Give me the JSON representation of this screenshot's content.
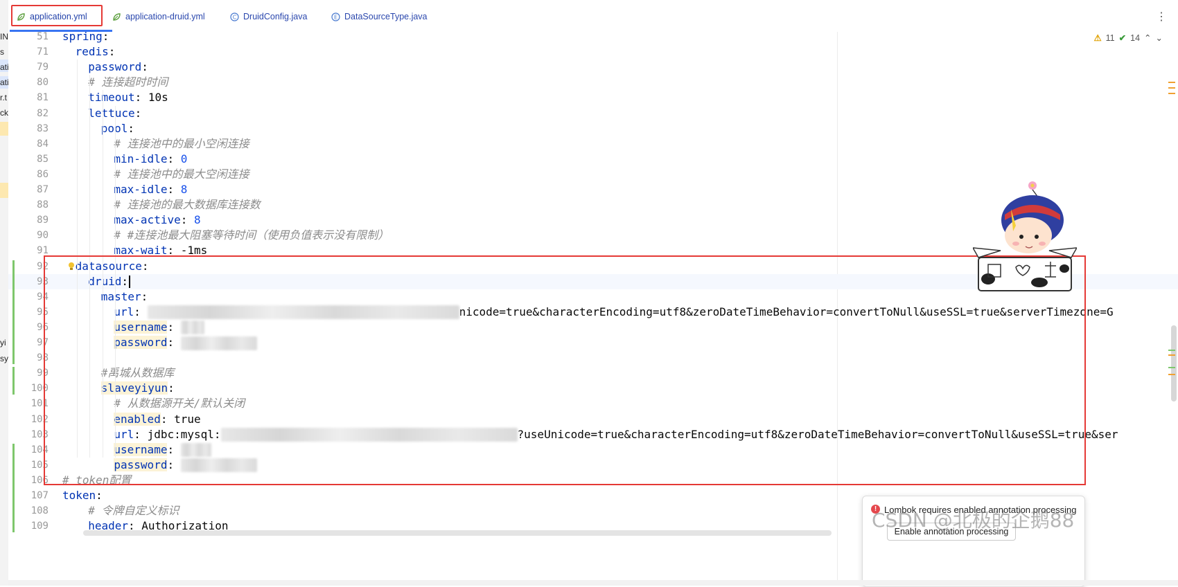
{
  "tabs": [
    {
      "label": "application.yml",
      "icon": "yaml-spring-icon",
      "active": true
    },
    {
      "label": "application-druid.yml",
      "icon": "yaml-spring-icon",
      "active": false
    },
    {
      "label": "DruidConfig.java",
      "icon": "java-class-icon",
      "active": false
    },
    {
      "label": "DataSourceType.java",
      "icon": "java-enum-icon",
      "active": false
    }
  ],
  "inspections": {
    "warnings": "11",
    "ok": "14"
  },
  "sidebar_fragments": [
    "IN",
    "s",
    "ati",
    "ati",
    "r.t",
    "ck.",
    "yi",
    "sy"
  ],
  "lines": [
    {
      "n": "51",
      "indent": 0,
      "key": "spring",
      "sep": ":",
      "val": ""
    },
    {
      "n": "71",
      "indent": 1,
      "key": "redis",
      "sep": ":",
      "val": ""
    },
    {
      "n": "79",
      "indent": 2,
      "key": "password",
      "sep": ":",
      "val": ""
    },
    {
      "n": "80",
      "indent": 2,
      "comment": "# 连接超时时间"
    },
    {
      "n": "81",
      "indent": 2,
      "key": "timeout",
      "sep": ":",
      "val": " 10s"
    },
    {
      "n": "82",
      "indent": 2,
      "key": "lettuce",
      "sep": ":",
      "val": ""
    },
    {
      "n": "83",
      "indent": 3,
      "key": "pool",
      "sep": ":",
      "val": ""
    },
    {
      "n": "84",
      "indent": 4,
      "comment": "# 连接池中的最小空闲连接"
    },
    {
      "n": "85",
      "indent": 4,
      "key": "min-idle",
      "sep": ":",
      "num": " 0"
    },
    {
      "n": "86",
      "indent": 4,
      "comment": "# 连接池中的最大空闲连接"
    },
    {
      "n": "87",
      "indent": 4,
      "key": "max-idle",
      "sep": ":",
      "num": " 8"
    },
    {
      "n": "88",
      "indent": 4,
      "comment": "# 连接池的最大数据库连接数"
    },
    {
      "n": "89",
      "indent": 4,
      "key": "max-active",
      "sep": ":",
      "num": " 8"
    },
    {
      "n": "90",
      "indent": 4,
      "comment": "# #连接池最大阻塞等待时间（使用负值表示没有限制）"
    },
    {
      "n": "91",
      "indent": 4,
      "key": "max-wait",
      "sep": ":",
      "val": " -1ms"
    },
    {
      "n": "92",
      "indent": 1,
      "key": "datasource",
      "sep": ":",
      "val": "",
      "bulb": true
    },
    {
      "n": "93",
      "indent": 2,
      "key": "druid",
      "sep": ":",
      "val": "",
      "caret": true
    },
    {
      "n": "94",
      "indent": 3,
      "key": "master",
      "sep": ":",
      "val": ""
    },
    {
      "n": "95",
      "indent": 4,
      "key": "url",
      "sep": ":",
      "val": " ",
      "blur": 450,
      "tail": "nicode=true&characterEncoding=utf8&zeroDateTimeBehavior=convertToNull&useSSL=true&serverTimezone=G"
    },
    {
      "n": "96",
      "indent": 4,
      "key": "username",
      "sep": ":",
      "val": " ",
      "blur": 34,
      "hlkey": true
    },
    {
      "n": "97",
      "indent": 4,
      "key": "password",
      "sep": ":",
      "val": " ",
      "blur": 110,
      "hlkey": true
    },
    {
      "n": "98",
      "indent": 0,
      "blank": true
    },
    {
      "n": "99",
      "indent": 3,
      "comment": "#禹城从数据库"
    },
    {
      "n": "100",
      "indent": 3,
      "key": "slaveyiyun",
      "sep": ":",
      "val": "",
      "hlkey": true
    },
    {
      "n": "101",
      "indent": 4,
      "comment": "# 从数据源开关/默认关闭"
    },
    {
      "n": "102",
      "indent": 4,
      "key": "enabled",
      "sep": ":",
      "val": " true",
      "hlkey": true
    },
    {
      "n": "103",
      "indent": 4,
      "key": "url",
      "sep": ":",
      "val": " jdbc:mysql:",
      "blur": 428,
      "tail": "?useUnicode=true&characterEncoding=utf8&zeroDateTimeBehavior=convertToNull&useSSL=true&ser"
    },
    {
      "n": "104",
      "indent": 4,
      "key": "username",
      "sep": ":",
      "val": " ",
      "blur": 44,
      "hlkey": true
    },
    {
      "n": "105",
      "indent": 4,
      "key": "password",
      "sep": ":",
      "val": " ",
      "blur": 110,
      "hlkey": true
    },
    {
      "n": "106",
      "indent": 0,
      "comment": "# token配置"
    },
    {
      "n": "107",
      "indent": 0,
      "key": "token",
      "sep": ":",
      "val": ""
    },
    {
      "n": "108",
      "indent": 2,
      "comment": "# 令牌自定义标识"
    },
    {
      "n": "109",
      "indent": 2,
      "key": "header",
      "sep": ":",
      "val": " Authorization"
    }
  ],
  "notification": {
    "message": "Lombok requires enabled annotation processing",
    "button": "Enable annotation processing"
  },
  "watermark": "CSDN @北极的企鹅88",
  "colors": {
    "highlight_box": "#e53935",
    "active_tab_underline": "#3874f2",
    "key": "#0033b3",
    "comment": "#8c8c8c",
    "number": "#1750eb"
  }
}
